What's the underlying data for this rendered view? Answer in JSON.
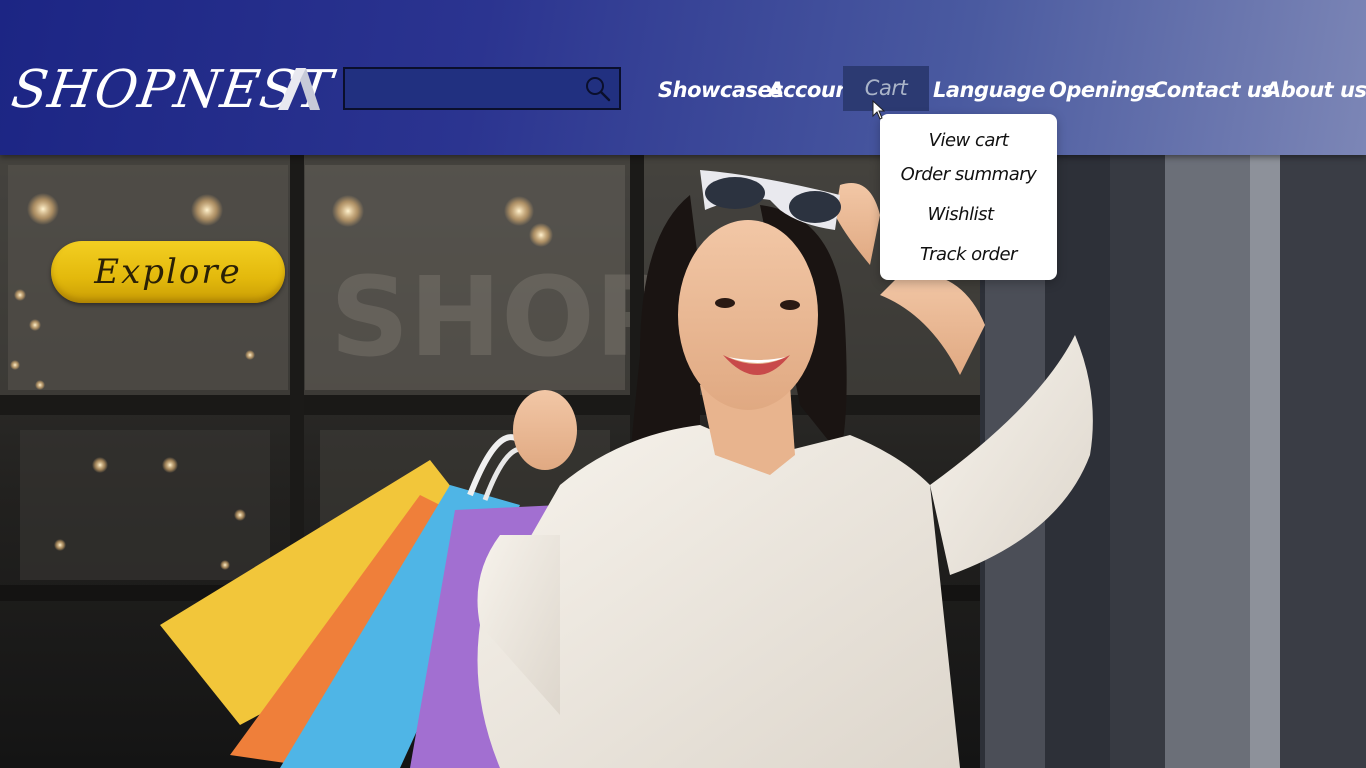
{
  "brand": {
    "name": "SHOPNEST"
  },
  "search": {
    "placeholder": "",
    "icon": "search-icon"
  },
  "nav": {
    "items": [
      {
        "label": "Showcases"
      },
      {
        "label": "Account"
      },
      {
        "label": "Cart",
        "active": true
      },
      {
        "label": "Language"
      },
      {
        "label": "Openings"
      },
      {
        "label": "Contact us"
      },
      {
        "label": "About us"
      }
    ]
  },
  "cart_menu": {
    "items": [
      {
        "label": "View cart"
      },
      {
        "label": "Order summary"
      },
      {
        "label": "Wishlist"
      },
      {
        "label": "Track order"
      }
    ]
  },
  "hero": {
    "cta_label": "Explore"
  },
  "colors": {
    "header_start": "#1c2584",
    "header_end": "#7c86b6",
    "cta_yellow": "#f0c81c",
    "dropdown_bg": "#ffffff"
  }
}
